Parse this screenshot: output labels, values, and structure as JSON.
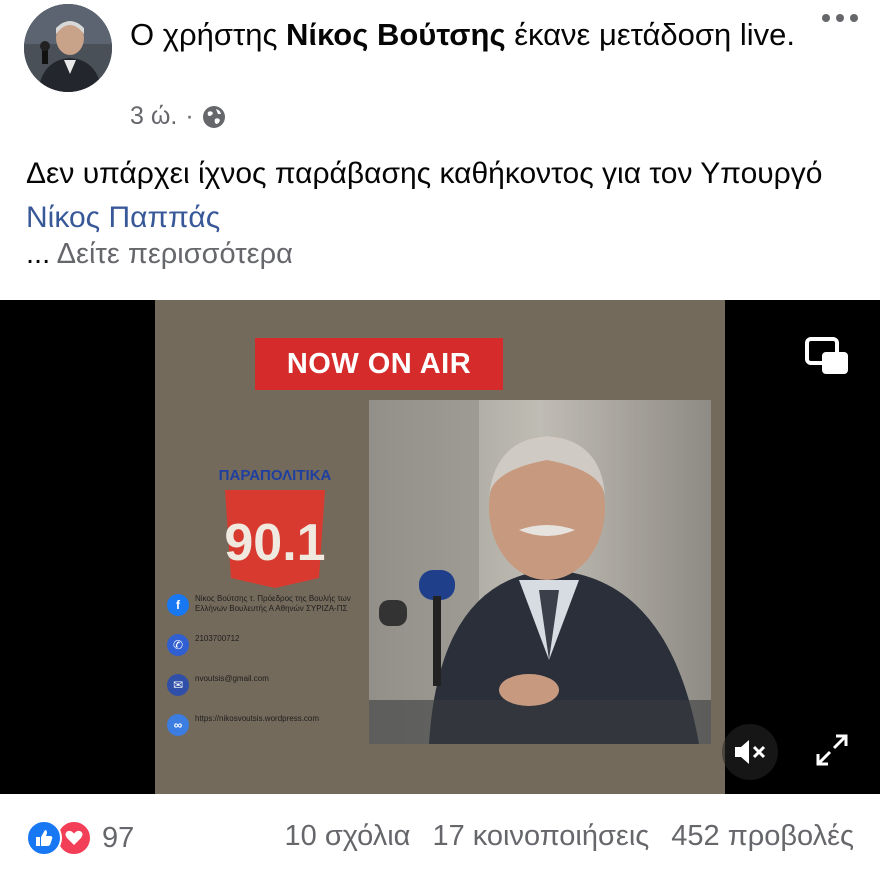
{
  "post": {
    "actor_prefix": "Ο χρήστης ",
    "actor_name": "Νίκος Βούτσης",
    "actor_action": " έκανε μετάδοση live.",
    "time": "3 ώ.",
    "separator": "·",
    "privacy_icon": "globe-icon",
    "more_icon": "more-options-icon"
  },
  "body": {
    "text": "Δεν υπάρχει ίχνος παράβασης καθήκοντος για τον Υπουργό ",
    "mention": "Νίκος Παππάς",
    "see_more_dots": "...",
    "see_more_label": "Δείτε περισσότερα"
  },
  "video": {
    "banner": "NOW ON AIR",
    "logo_title": "ΠΑΡΑΠΟΛΙΤΙΚΑ",
    "logo_number": "90.1",
    "contacts": [
      {
        "icon": "facebook-icon",
        "color": "#1877f2",
        "text": "Νίκος Βούτσης τ. Πρόεδρος της Βουλής των Ελλήνων Βουλευτής Α Αθηνών ΣΥΡΙΖΑ-ΠΣ"
      },
      {
        "icon": "phone-icon",
        "color": "#2f5fd0",
        "text": "2103700712"
      },
      {
        "icon": "mail-icon",
        "color": "#2f4fa8",
        "text": "nvoutsis@gmail.com"
      },
      {
        "icon": "link-icon",
        "color": "#3b7de0",
        "text": "https://nikosvoutsis.wordpress.com"
      }
    ],
    "controls": [
      "pip-icon",
      "mute-icon",
      "fullscreen-icon"
    ]
  },
  "footer": {
    "reaction_count": "97",
    "comments": "10 σχόλια",
    "shares": "17 κοινοποιήσεις",
    "views": "452 προβολές"
  },
  "colors": {
    "link": "#385898",
    "secondary_text": "#65676b",
    "like_blue": "#1877f2",
    "love_red": "#f33e58",
    "banner_red": "#d62b2b"
  }
}
